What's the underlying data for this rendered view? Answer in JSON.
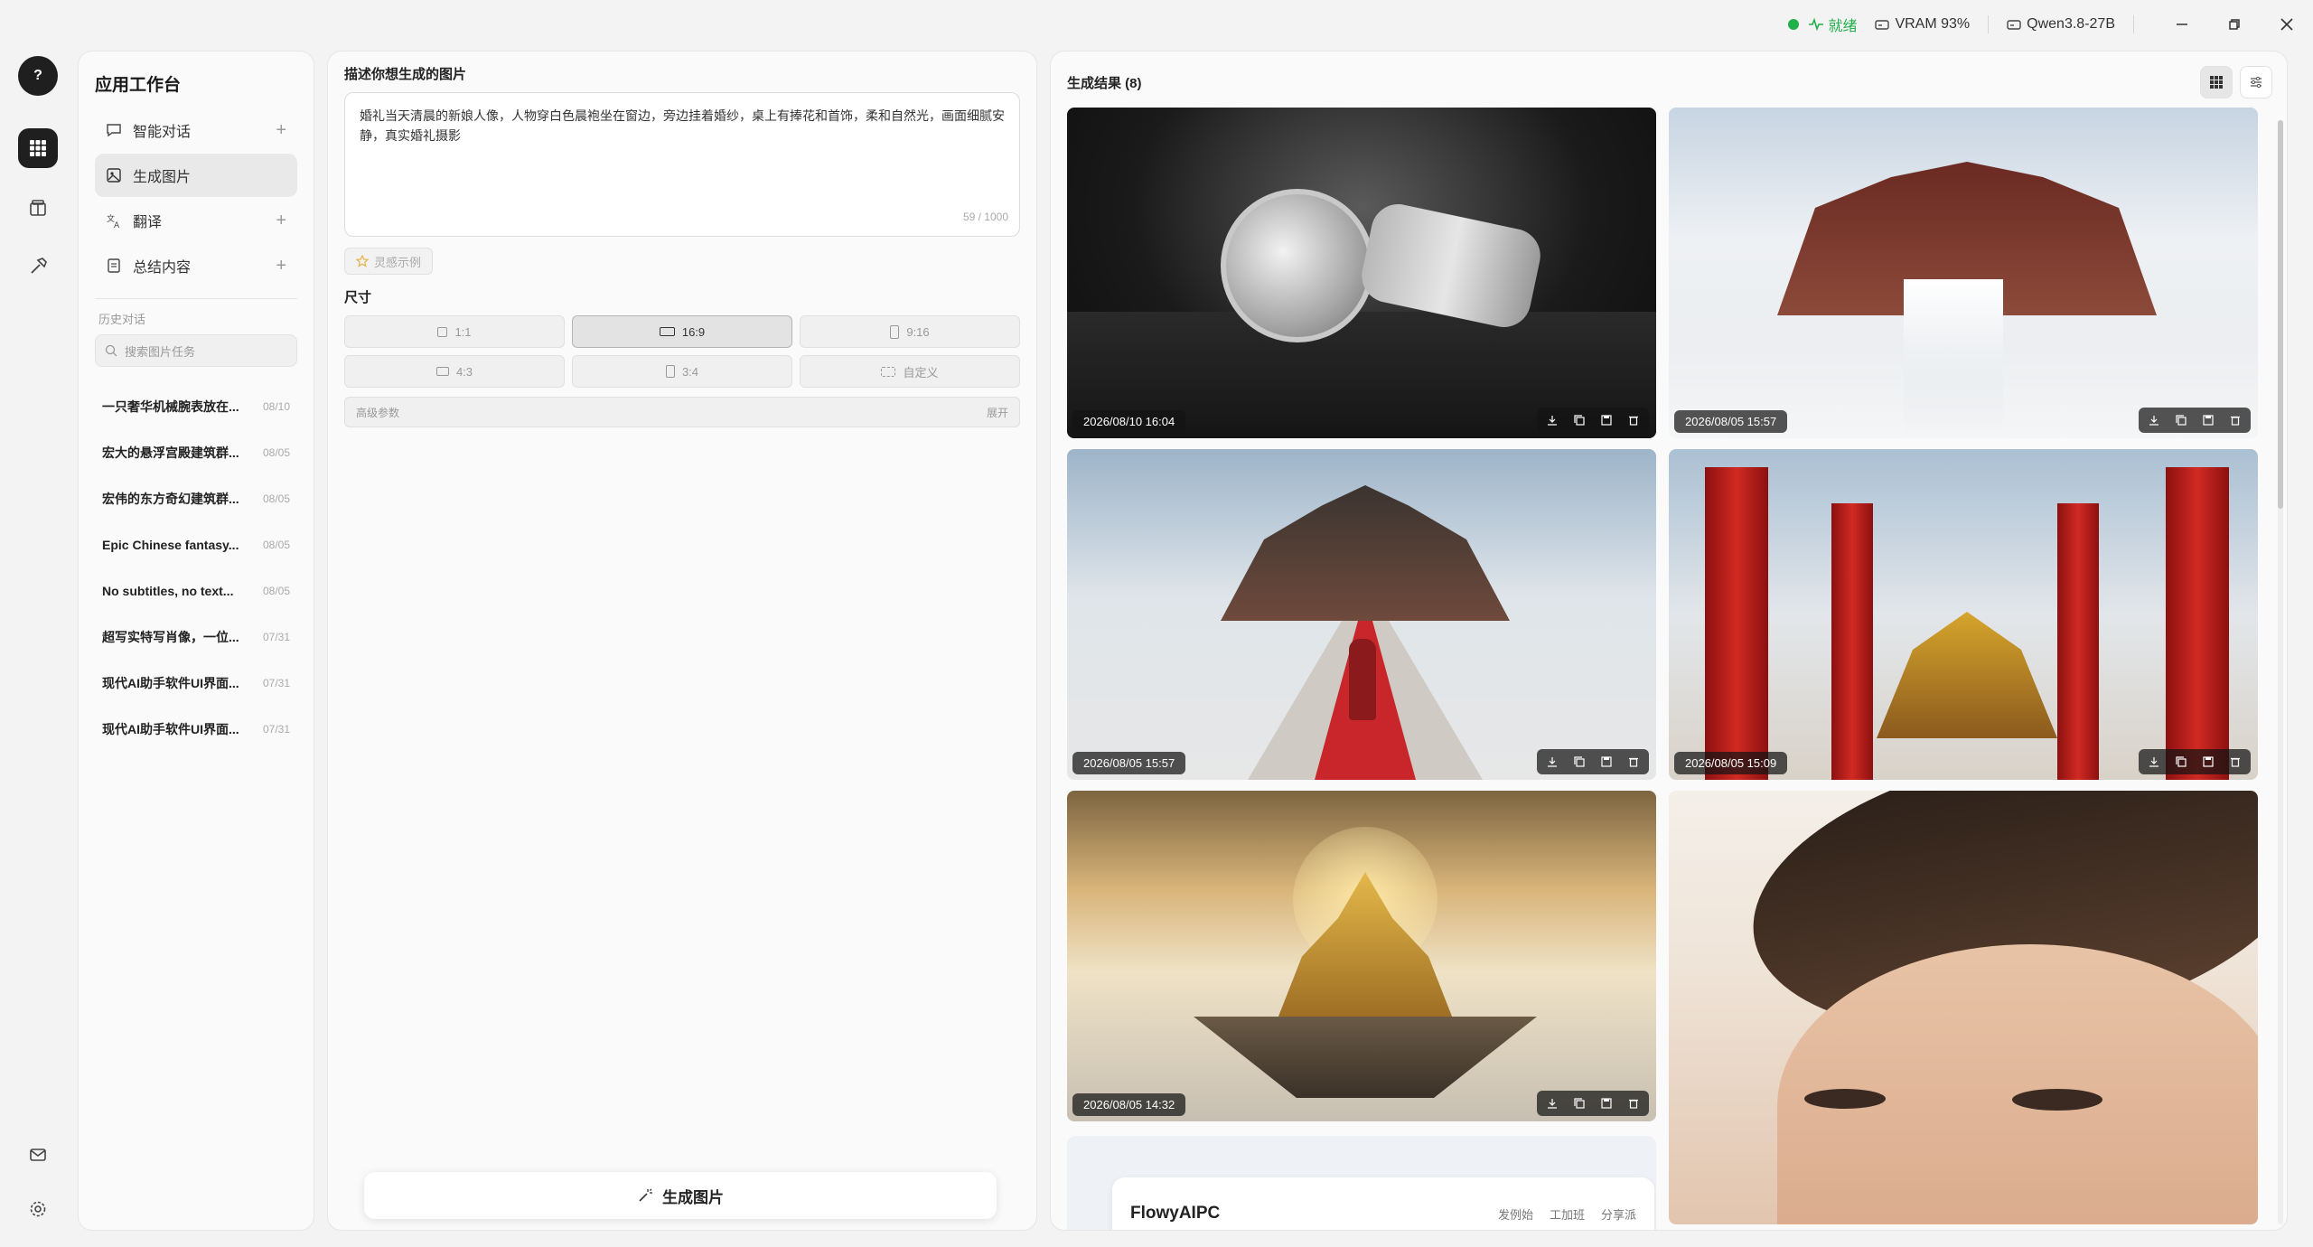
{
  "status": {
    "ready": "就绪",
    "vram": "VRAM 93%",
    "model": "Qwen3.8-27B"
  },
  "rail": {
    "help": "?"
  },
  "sidebar": {
    "title": "应用工作台",
    "nav": [
      {
        "label": "智能对话"
      },
      {
        "label": "生成图片"
      },
      {
        "label": "翻译"
      },
      {
        "label": "总结内容"
      }
    ],
    "history_label": "历史对话",
    "search_placeholder": "搜索图片任务",
    "history": [
      {
        "title": "一只奢华机械腕表放在...",
        "date": "08/10"
      },
      {
        "title": "宏大的悬浮宫殿建筑群...",
        "date": "08/05"
      },
      {
        "title": "宏伟的东方奇幻建筑群...",
        "date": "08/05"
      },
      {
        "title": "Epic Chinese fantasy...",
        "date": "08/05"
      },
      {
        "title": "No subtitles, no text...",
        "date": "08/05"
      },
      {
        "title": "超写实特写肖像，一位...",
        "date": "07/31"
      },
      {
        "title": "现代AI助手软件UI界面...",
        "date": "07/31"
      },
      {
        "title": "现代AI助手软件UI界面...",
        "date": "07/31"
      }
    ]
  },
  "prompt": {
    "title": "描述你想生成的图片",
    "text": "婚礼当天清晨的新娘人像，人物穿白色晨袍坐在窗边，旁边挂着婚纱，桌上有捧花和首饰，柔和自然光，画面细腻安静，真实婚礼摄影",
    "counter": "59 / 1000",
    "inspire": "灵感示例",
    "size_title": "尺寸",
    "sizes": [
      {
        "label": "1:1"
      },
      {
        "label": "16:9"
      },
      {
        "label": "9:16"
      },
      {
        "label": "4:3"
      },
      {
        "label": "3:4"
      },
      {
        "label": "自定义"
      }
    ],
    "advanced": "高级参数",
    "expand": "展开",
    "generate": "生成图片"
  },
  "results": {
    "title": "生成结果 (8)",
    "items": [
      {
        "timestamp": "2026/08/10 16:04"
      },
      {
        "timestamp": "2026/08/05 15:57"
      },
      {
        "timestamp": "2026/08/05 15:57"
      },
      {
        "timestamp": "2026/08/05 15:09"
      },
      {
        "timestamp": "2026/08/05 14:32"
      }
    ],
    "web_preview": {
      "logo": "FlowyAIPC",
      "links": [
        "发例始",
        "工加班",
        "分享派"
      ]
    }
  }
}
